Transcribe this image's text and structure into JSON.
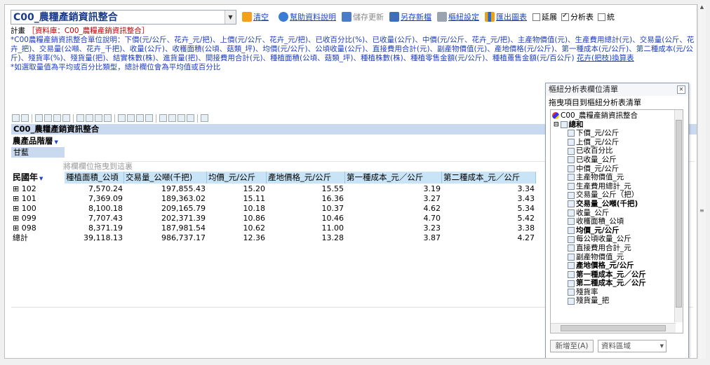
{
  "toolbar": {
    "selector_value": "C00_農糧產銷資訊整合",
    "clear": "清空",
    "help": "幫助資料說明",
    "save_update": "儲存更新",
    "save_new": "另存新檔",
    "pivot_settings": "樞紐設定",
    "export_chart": "匯出圖表",
    "opt_extend": "延展",
    "opt_pivot": "分析表",
    "opt_stat": "統"
  },
  "description": {
    "line1_label": "計畫",
    "line1_source": "［資料庫：C00_農糧產銷資訊整合］",
    "body": "*C00農糧產銷資訊整合單位說明：下價(元/公斤、花卉_元/把)、上價(元/公斤、花卉_元/把)、已收百分比(%)、已收量(公斤)、中價(元/公斤、花卉_元/把)、主產物價值(元)、生產費用總計(元)、交易量(公斤、花卉_把)、交易量(公噸、花卉_千把)、收量(公斤)、收穫面積(公頃、菇類_坪)、均價(元/公斤)、公頃收量(公斤)、直接費用合計(元)、副產物價值(元)、產地價格(元/公斤)、第一種成本(元/公斤)、第二種成本(元/公斤)、殘貨率(%)、殘貨量(把)、結實株數(株)、進貨量(把)、間接費用合計(元)、種植面積(公頃、菇類_坪)、種植株數(株)、種植零售金額(元/公斤)、種植躉售金額(元/百公斤)",
    "body_link": "花卉(把枝)換算表",
    "note": "*如選取量值為平均或百分比類型，總計欄位會為平均值或百分比"
  },
  "pivot": {
    "title": "C00_農糧產銷資訊整合",
    "layer_label": "農產品階層",
    "layer_value": "甘藍",
    "dropzone": "將欄欄位拖曳到這裏",
    "row_header": "民國年",
    "columns": [
      "種植面積_公頃",
      "交易量_公噸(千把)",
      "均價_元/公斤",
      "產地價格_元/公斤",
      "第一種成本_元／公斤",
      "第二種成本_元／公斤"
    ],
    "rows": [
      {
        "label": "⊞ 102",
        "values": [
          "7,570.24",
          "197,855.43",
          "15.20",
          "15.55",
          "3.19",
          "3.34"
        ]
      },
      {
        "label": "⊞ 101",
        "values": [
          "7,369.09",
          "189,363.02",
          "15.11",
          "16.36",
          "3.27",
          "3.43"
        ]
      },
      {
        "label": "⊞ 100",
        "values": [
          "8,100.18",
          "209,165.79",
          "10.18",
          "10.37",
          "4.62",
          "5.34"
        ]
      },
      {
        "label": "⊞ 099",
        "values": [
          "7,707.43",
          "202,371.39",
          "10.86",
          "10.46",
          "4.70",
          "5.42"
        ]
      },
      {
        "label": "⊞ 098",
        "values": [
          "8,371.19",
          "187,981.54",
          "10.62",
          "11.00",
          "3.23",
          "3.38"
        ]
      },
      {
        "label": "總計",
        "values": [
          "39,118.13",
          "986,737.17",
          "12.36",
          "13.28",
          "3.87",
          "4.27"
        ]
      }
    ]
  },
  "field_list": {
    "header": "樞紐分析表欄位清單",
    "subtitle": "拖曳項目到樞紐分析表清單",
    "root": "C00_農糧產銷資訊整合",
    "group": "總和",
    "items": [
      {
        "label": "下價_元/公斤",
        "bold": false
      },
      {
        "label": "上價_元/公斤",
        "bold": false
      },
      {
        "label": "已收百分比",
        "bold": false
      },
      {
        "label": "已收量_公斤",
        "bold": false
      },
      {
        "label": "中價_元/公斤",
        "bold": false
      },
      {
        "label": "主產物價值_元",
        "bold": false
      },
      {
        "label": "生產費用總計_元",
        "bold": false
      },
      {
        "label": "交易量_公斤（把）",
        "bold": false
      },
      {
        "label": "交易量_公噸(千把)",
        "bold": true
      },
      {
        "label": "收量_公斤",
        "bold": false
      },
      {
        "label": "收穫面積_公頃",
        "bold": false
      },
      {
        "label": "均價_元/公斤",
        "bold": true
      },
      {
        "label": "每公頃收量_公斤",
        "bold": false
      },
      {
        "label": "直接費用合計_元",
        "bold": false
      },
      {
        "label": "副產物價值_元",
        "bold": false
      },
      {
        "label": "產地價格_元/公斤",
        "bold": true
      },
      {
        "label": "第一種成本_元／公斤",
        "bold": true
      },
      {
        "label": "第二種成本_元／公斤",
        "bold": true
      },
      {
        "label": "殘貨率",
        "bold": false
      },
      {
        "label": "殘貨量_把",
        "bold": false
      }
    ],
    "add_button": "新增至(A)",
    "area_select": "資料區域"
  }
}
